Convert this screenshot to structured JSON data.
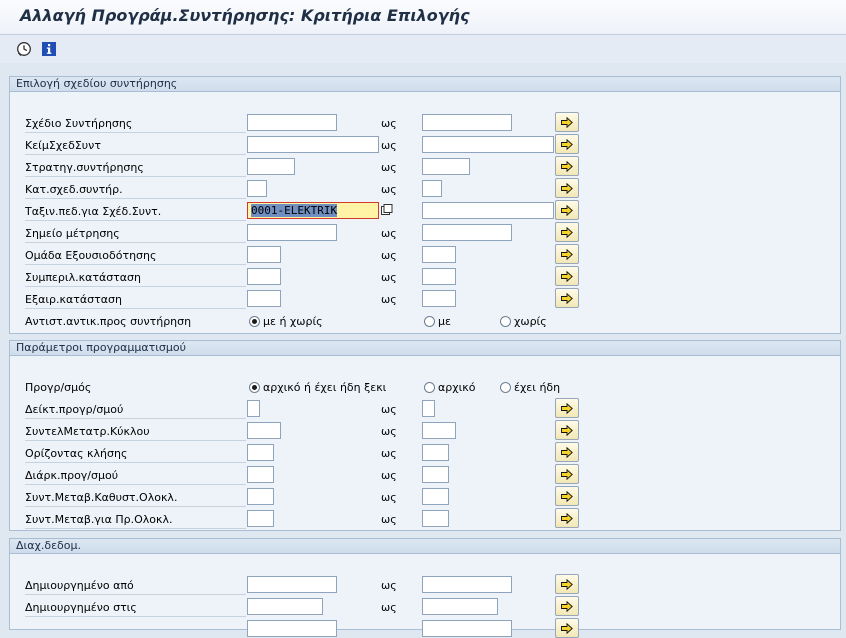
{
  "window": {
    "title": "Αλλαγή Προγράμ.Συντήρησης: Κριτήρια Επιλογής"
  },
  "toolbar": {
    "execute_icon": "execute-clock-icon",
    "info_icon": "info-icon"
  },
  "to_label": "ως",
  "group1": {
    "title": "Επιλογή σχεδίου συντήρησης",
    "rows": [
      {
        "label": "Σχέδιο Συντήρησης",
        "from": "",
        "to": ""
      },
      {
        "label": "ΚείμΣχεδΣυντ",
        "from": "",
        "to": ""
      },
      {
        "label": "Στρατηγ.συντήρησης",
        "from": "",
        "to": ""
      },
      {
        "label": "Κατ.σχεδ.συντήρ.",
        "from": "",
        "to": ""
      },
      {
        "label": "Ταξιν.πεδ.για Σχέδ.Συντ.",
        "from": "0001-ELEKTRIK",
        "to": ""
      },
      {
        "label": "Σημείο μέτρησης",
        "from": "",
        "to": ""
      },
      {
        "label": "Ομάδα Εξουσιοδότησης",
        "from": "",
        "to": ""
      },
      {
        "label": "Συμπεριλ.κατάσταση",
        "from": "",
        "to": ""
      },
      {
        "label": "Εξαιρ.κατάσταση",
        "from": "",
        "to": ""
      }
    ],
    "radio_row": {
      "label": "Αντιστ.αντικ.προς συντήρηση",
      "options": [
        "με ή χωρίς",
        "με",
        "χωρίς"
      ],
      "selected": 0
    }
  },
  "group2": {
    "title": "Παράμετροι προγραμματισμού",
    "radio_row": {
      "label": "Προγρ/σμός",
      "options": [
        "αρχικό ή έχει ήδη ξεκι",
        "αρχικό",
        "έχει ήδη"
      ],
      "selected": 0
    },
    "rows": [
      {
        "label": "Δείκτ.προγρ/σμού",
        "from": "",
        "to": ""
      },
      {
        "label": "ΣυντελΜετατρ.Κύκλου",
        "from": "",
        "to": ""
      },
      {
        "label": "Ορίζοντας κλήσης",
        "from": "",
        "to": ""
      },
      {
        "label": "Διάρκ.προγ/σμού",
        "from": "",
        "to": ""
      },
      {
        "label": "Συντ.Μεταβ.Καθυστ.Ολοκλ.",
        "from": "",
        "to": ""
      },
      {
        "label": "Συντ.Μεταβ.για Πρ.Ολοκλ.",
        "from": "",
        "to": ""
      }
    ]
  },
  "group3": {
    "title": "Διαχ.δεδομ.",
    "rows": [
      {
        "label": "Δημιουργημένο από",
        "from": "",
        "to": ""
      },
      {
        "label": "Δημιουργημένο στις",
        "from": "",
        "to": ""
      }
    ]
  },
  "colors": {
    "background": "#dfe7f1",
    "group_header": "#cfdceb",
    "focus_field": "#fff4a6",
    "focus_border": "#d23a2c",
    "selection": "#6e8fc0",
    "multi_select_button": "#f2e7b4"
  }
}
